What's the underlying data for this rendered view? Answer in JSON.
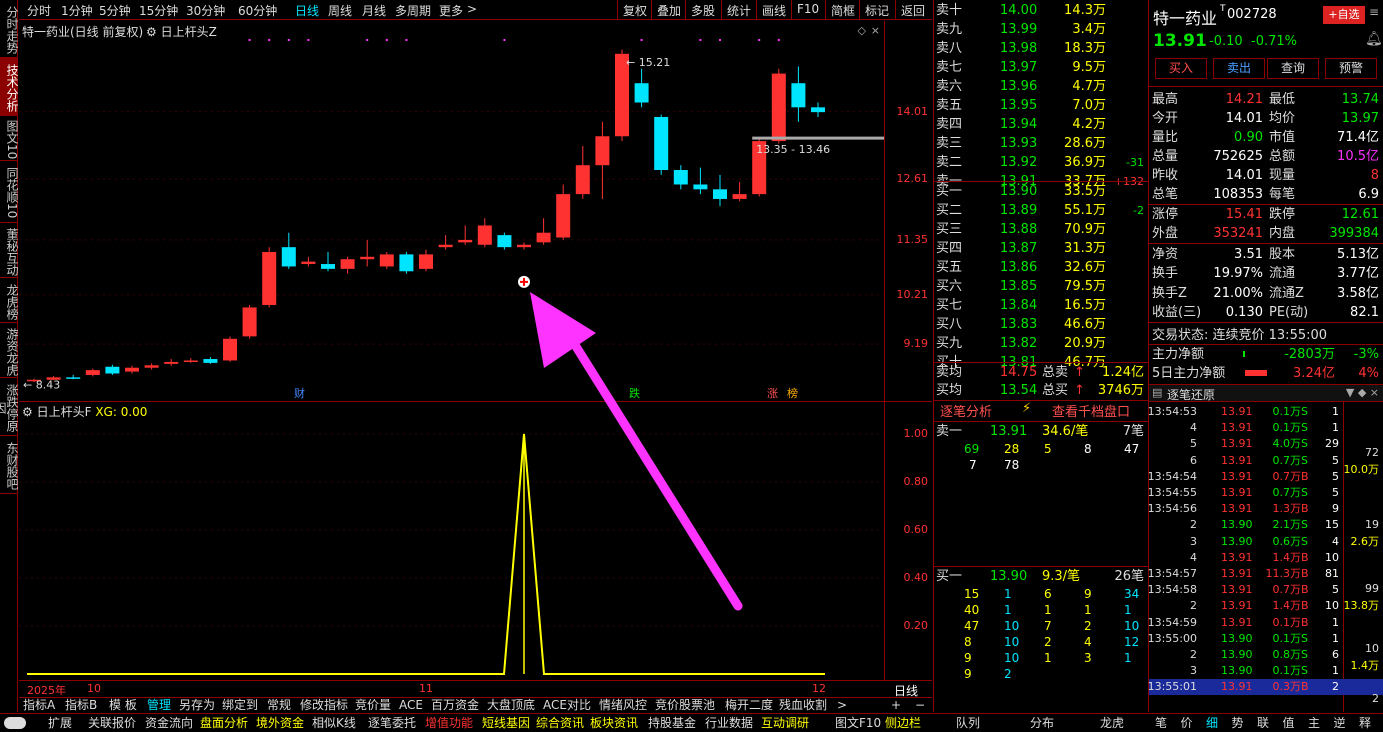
{
  "left_tabs": [
    "分时走势",
    "技术分析",
    "图文10",
    "同花顺10",
    "董秘互动",
    "龙虎榜",
    "游资龙虎",
    "涨跌停原因",
    "东财股吧"
  ],
  "top_periods": [
    "分时",
    "1分钟",
    "5分钟",
    "15分钟",
    "30分钟",
    "60分钟",
    "日线",
    "周线",
    "月线",
    "多周期",
    "更多"
  ],
  "top_tools": [
    "复权",
    "叠加",
    "多股",
    "统计",
    "画线",
    "F10",
    "简框",
    "标记",
    "返回"
  ],
  "chart_title": "特一药业(日线 前复权)",
  "indicator_title": "日上杆头Z",
  "price_axis": [
    "14.01",
    "12.61",
    "11.35",
    "10.21",
    "9.19"
  ],
  "high_label": "15.21",
  "low_label": "8.43",
  "range_label": "13.35 - 13.46",
  "event_marks": [
    "财",
    "跌",
    "涨",
    "榜"
  ],
  "sub_title": "日上杆头F",
  "sub_value": "XG: 0.00",
  "sub_axis": [
    "1.00",
    "0.80",
    "0.60",
    "0.40",
    "0.20"
  ],
  "date_labels": [
    "2025年",
    "10",
    "11",
    "12"
  ],
  "period_tag": "日线",
  "bottom_tabs1": [
    "指标A",
    "指标B",
    "模 板",
    "管理",
    "另存为",
    "绑定到",
    "常规",
    "修改指标",
    "竞价量",
    "ACE",
    "百万资金",
    "大盘顶底",
    "ACE对比",
    "情绪风控",
    "竞价股票池",
    "梅开二度",
    "残血收割"
  ],
  "bottom_tabs2": [
    "扩展",
    "关联报价",
    "资金流向",
    "盘面分析",
    "境外资金",
    "相似K线",
    "逐笔委托",
    "增值功能",
    "短线基因",
    "综合资讯",
    "板块资讯",
    "持股基金",
    "行业数据",
    "互动调研",
    "图文F10",
    "侧边栏"
  ],
  "bottom_tabs3": [
    "队列",
    "分布",
    "龙虎"
  ],
  "bottom_tabs4": [
    "笔",
    "价",
    "细",
    "势",
    "联",
    "值",
    "主",
    "逆",
    "释"
  ],
  "chart_data": {
    "type": "candlestick",
    "ylim": [
      8.3,
      15.6
    ],
    "candles": [
      [
        8.43,
        8.45,
        8.4,
        8.47
      ],
      [
        8.45,
        8.5,
        8.44,
        8.53
      ],
      [
        8.5,
        8.49,
        8.46,
        8.55
      ],
      [
        8.55,
        8.65,
        8.52,
        8.68
      ],
      [
        8.72,
        8.58,
        8.55,
        8.76
      ],
      [
        8.62,
        8.7,
        8.58,
        8.74
      ],
      [
        8.7,
        8.75,
        8.66,
        8.79
      ],
      [
        8.78,
        8.82,
        8.74,
        8.88
      ],
      [
        8.82,
        8.85,
        8.8,
        8.9
      ],
      [
        8.88,
        8.8,
        8.78,
        8.92
      ],
      [
        8.85,
        9.3,
        8.82,
        9.35
      ],
      [
        9.35,
        9.95,
        9.3,
        10.0
      ],
      [
        10.0,
        11.1,
        9.95,
        11.2
      ],
      [
        11.2,
        10.8,
        10.75,
        11.5
      ],
      [
        10.85,
        10.9,
        10.8,
        11.0
      ],
      [
        10.85,
        10.75,
        10.7,
        11.1
      ],
      [
        10.75,
        10.95,
        10.65,
        11.0
      ],
      [
        10.95,
        11.0,
        10.8,
        11.35
      ],
      [
        10.8,
        11.05,
        10.75,
        11.1
      ],
      [
        11.05,
        10.7,
        10.65,
        11.1
      ],
      [
        10.75,
        11.05,
        10.7,
        11.15
      ],
      [
        11.2,
        11.25,
        11.15,
        11.45
      ],
      [
        11.3,
        11.35,
        11.25,
        11.65
      ],
      [
        11.25,
        11.65,
        11.2,
        11.8
      ],
      [
        11.45,
        11.2,
        11.15,
        11.5
      ],
      [
        11.2,
        11.25,
        11.15,
        11.3
      ],
      [
        11.3,
        11.5,
        11.25,
        11.8
      ],
      [
        11.4,
        12.3,
        11.35,
        12.5
      ],
      [
        12.3,
        12.9,
        12.2,
        13.3
      ],
      [
        12.9,
        13.5,
        12.2,
        13.8
      ],
      [
        13.5,
        15.21,
        13.4,
        15.3
      ],
      [
        14.6,
        14.2,
        14.1,
        14.9
      ],
      [
        13.9,
        12.8,
        12.7,
        13.95
      ],
      [
        12.8,
        12.5,
        12.4,
        12.9
      ],
      [
        12.5,
        12.4,
        12.3,
        12.85
      ],
      [
        12.4,
        12.2,
        12.05,
        12.7
      ],
      [
        12.2,
        12.3,
        12.15,
        12.55
      ],
      [
        12.3,
        13.4,
        12.25,
        13.45
      ],
      [
        13.4,
        14.8,
        13.35,
        14.9
      ],
      [
        14.6,
        14.1,
        13.8,
        14.95
      ],
      [
        14.1,
        14.0,
        13.9,
        14.2
      ]
    ],
    "signal": {
      "index": 25,
      "value": 1.0
    },
    "subylim": [
      0,
      1.05
    ]
  },
  "order_book": {
    "asks": [
      [
        "卖十",
        "14.00",
        "14.3万"
      ],
      [
        "卖九",
        "13.99",
        "3.4万"
      ],
      [
        "卖八",
        "13.98",
        "18.3万"
      ],
      [
        "卖七",
        "13.97",
        "9.5万"
      ],
      [
        "卖六",
        "13.96",
        "4.7万"
      ],
      [
        "卖五",
        "13.95",
        "7.0万"
      ],
      [
        "卖四",
        "13.94",
        "4.2万"
      ],
      [
        "卖三",
        "13.93",
        "28.6万"
      ],
      [
        "卖二",
        "13.92",
        "36.9万"
      ],
      [
        "卖一",
        "13.91",
        "33.7万"
      ]
    ],
    "ask_chg": [
      "",
      "",
      "",
      "",
      "",
      "",
      "",
      "",
      "-31",
      "+132"
    ],
    "bids": [
      [
        "买一",
        "13.90",
        "33.5万"
      ],
      [
        "买二",
        "13.89",
        "55.1万"
      ],
      [
        "买三",
        "13.88",
        "70.9万"
      ],
      [
        "买四",
        "13.87",
        "31.3万"
      ],
      [
        "买五",
        "13.86",
        "32.6万"
      ],
      [
        "买六",
        "13.85",
        "79.5万"
      ],
      [
        "买七",
        "13.84",
        "16.5万"
      ],
      [
        "买八",
        "13.83",
        "46.6万"
      ],
      [
        "买九",
        "13.82",
        "20.9万"
      ],
      [
        "买十",
        "13.81",
        "46.7万"
      ]
    ],
    "bid_chg": [
      "",
      "-2",
      "",
      "",
      "",
      "",
      "",
      "",
      "",
      ""
    ],
    "avg_ask": {
      "label": "卖均",
      "price": "14.75",
      "tlabel": "总卖",
      "total": "1.24亿"
    },
    "avg_bid": {
      "label": "买均",
      "price": "13.54",
      "tlabel": "总买",
      "total": "3746万"
    },
    "tabs": [
      "逐笔分析",
      "查看千档盘口"
    ],
    "sell1": {
      "label": "卖一",
      "price": "13.91",
      "avg": "34.6/笔",
      "count": "7笔",
      "q": [
        "69",
        "28",
        "5",
        "8",
        "47",
        "7",
        "78"
      ]
    },
    "buy1": {
      "label": "买一",
      "price": "13.90",
      "avg": "9.3/笔",
      "count": "26笔",
      "q": [
        "15",
        "1",
        "6",
        "9",
        "34",
        "40",
        "1",
        "1",
        "1",
        "1",
        "47",
        "10",
        "7",
        "2",
        "10",
        "8",
        "10",
        "2",
        "4",
        "12",
        "9",
        "10",
        "1",
        "3",
        "1",
        "9",
        "2"
      ]
    }
  },
  "stock": {
    "name": "特一药业",
    "tag": "T",
    "code": "002728",
    "add_btn": "+自选",
    "price": "13.91",
    "chg": "-0.10",
    "pct": "-0.71%",
    "buttons": [
      "买入",
      "卖出",
      "查询",
      "预警"
    ]
  },
  "stats": [
    [
      "最高",
      "14.21",
      "最低",
      "13.74"
    ],
    [
      "今开",
      "14.01",
      "均价",
      "13.97"
    ],
    [
      "量比",
      "0.90",
      "市值",
      "71.4亿"
    ],
    [
      "总量",
      "752625",
      "总额",
      "10.5亿"
    ],
    [
      "昨收",
      "14.01",
      "现量",
      "8"
    ],
    [
      "总笔",
      "108353",
      "每笔",
      "6.9"
    ],
    [
      "涨停",
      "15.41",
      "跌停",
      "12.61"
    ],
    [
      "外盘",
      "353241",
      "内盘",
      "399384"
    ],
    [
      "净资",
      "3.51",
      "股本",
      "5.13亿"
    ],
    [
      "换手",
      "19.97%",
      "流通",
      "3.77亿"
    ],
    [
      "换手Z",
      "21.00%",
      "流通Z",
      "3.58亿"
    ],
    [
      "收益(三)",
      "0.130",
      "PE(动)",
      "82.1"
    ]
  ],
  "trade_status": "交易状态: 连续竞价 13:55:00",
  "capital": [
    {
      "label": "主力净额",
      "val": "-2803万",
      "pct": "-3%"
    },
    {
      "label": "5日主力净额",
      "val": "3.24亿",
      "pct": "4%"
    }
  ],
  "ticks_title": "逐笔还原",
  "ticks": [
    [
      "13:54:53",
      "13.91",
      "0.1万",
      "S",
      "1"
    ],
    [
      "4",
      "13.91",
      "0.1万",
      "S",
      "1"
    ],
    [
      "5",
      "13.91",
      "4.0万",
      "S",
      "29"
    ],
    [
      "6",
      "13.91",
      "0.7万",
      "S",
      "5"
    ],
    [
      "13:54:54",
      "13.91",
      "0.7万",
      "B",
      "5"
    ],
    [
      "13:54:55",
      "13.91",
      "0.7万",
      "S",
      "5"
    ],
    [
      "13:54:56",
      "13.91",
      "1.3万",
      "B",
      "9"
    ],
    [
      "2",
      "13.90",
      "2.1万",
      "S",
      "15"
    ],
    [
      "3",
      "13.90",
      "0.6万",
      "S",
      "4"
    ],
    [
      "4",
      "13.91",
      "1.4万",
      "B",
      "10"
    ],
    [
      "13:54:57",
      "13.91",
      "11.3万",
      "B",
      "81"
    ],
    [
      "13:54:58",
      "13.91",
      "0.7万",
      "B",
      "5"
    ],
    [
      "2",
      "13.91",
      "1.4万",
      "B",
      "10"
    ],
    [
      "13:54:59",
      "13.91",
      "0.1万",
      "B",
      "1"
    ],
    [
      "13:55:00",
      "13.90",
      "0.1万",
      "S",
      "1"
    ],
    [
      "2",
      "13.90",
      "0.8万",
      "S",
      "6"
    ],
    [
      "3",
      "13.90",
      "0.1万",
      "S",
      "1"
    ],
    [
      "13:55:01",
      "13.91",
      "0.3万",
      "B",
      "2"
    ]
  ],
  "tick_side": [
    {
      "n": "72",
      "v": "10.0万"
    },
    {
      "n": "19",
      "v": "2.6万"
    },
    {
      "n": "99",
      "v": "13.8万"
    },
    {
      "n": "10",
      "v": "1.4万"
    },
    {
      "n": "2",
      "v": ""
    }
  ],
  "colors": {
    "up": "#ff3232",
    "down": "#00e5ff",
    "bg": "#000000",
    "border": "#8b0000",
    "signal": "#ffff00",
    "arrow": "#ff33ff"
  }
}
